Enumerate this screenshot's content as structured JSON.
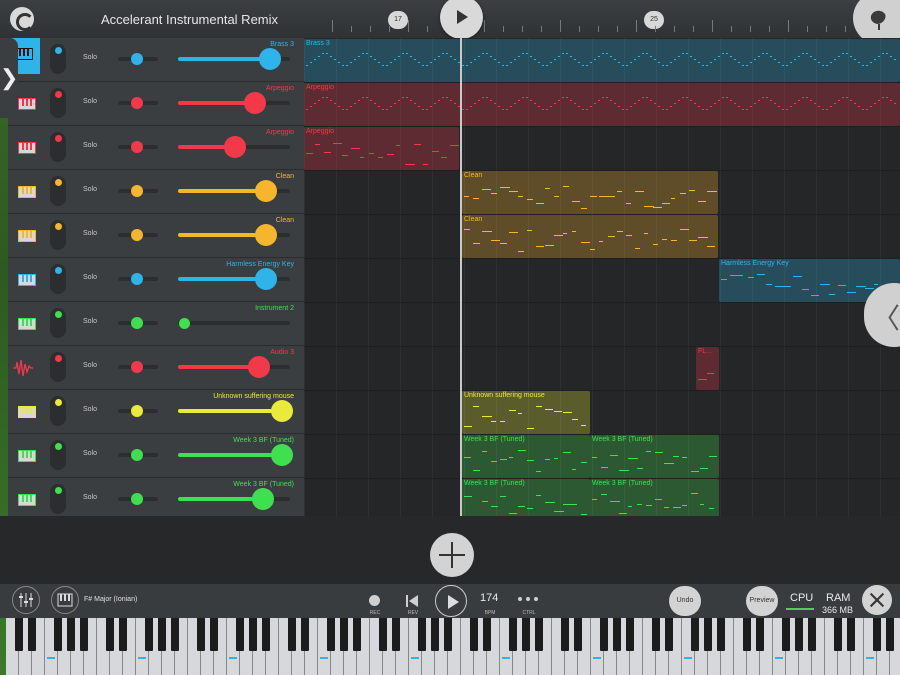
{
  "header": {
    "title": "Accelerant Instrumental Remix",
    "bar_markers": [
      "17",
      "25"
    ]
  },
  "colors": {
    "blue": "#2fb4e9",
    "red": "#f2394a",
    "orange": "#f5b52c",
    "green": "#3fe04f",
    "yellow": "#eaea3a"
  },
  "channels": [
    {
      "name": "Brass 3",
      "color": "blue",
      "icon": "piano-keys-icon",
      "solo": "Solo",
      "vol": 0.88,
      "selected": true
    },
    {
      "name": "Arpeggio",
      "color": "red",
      "icon": "piano-keys-icon",
      "solo": "Solo",
      "vol": 0.74
    },
    {
      "name": "Arpeggio",
      "color": "red",
      "icon": "piano-keys-icon",
      "solo": "Solo",
      "vol": 0.55
    },
    {
      "name": "Clean",
      "color": "orange",
      "icon": "piano-keys-icon",
      "solo": "Solo",
      "vol": 0.85
    },
    {
      "name": "Clean",
      "color": "orange",
      "icon": "piano-keys-icon",
      "solo": "Solo",
      "vol": 0.85
    },
    {
      "name": "Harmless Energy Key",
      "color": "blue",
      "icon": "piano-keys-icon",
      "solo": "Solo",
      "vol": 0.85
    },
    {
      "name": "Instrument 2",
      "color": "green",
      "icon": "piano-keys-icon",
      "solo": "Solo",
      "vol": 0.0
    },
    {
      "name": "Audio 3",
      "color": "red",
      "icon": "waveform-icon",
      "solo": "Solo",
      "vol": 0.78
    },
    {
      "name": "Unknown suffering mouse",
      "color": "yellow",
      "icon": "piano-keys-icon",
      "solo": "Solo",
      "vol": 1.0
    },
    {
      "name": "Week 3 BF (Tuned)",
      "color": "green",
      "icon": "piano-keys-icon",
      "solo": "Solo",
      "vol": 1.0
    },
    {
      "name": "Week 3 BF (Tuned)",
      "color": "green",
      "icon": "piano-keys-icon",
      "solo": "Solo",
      "vol": 0.82
    }
  ],
  "clips": [
    {
      "label": "Brass 3",
      "lane": 0,
      "start": 0.0,
      "end": 1.0,
      "color": "blue"
    },
    {
      "label": "Arpeggio",
      "lane": 1,
      "start": 0.0,
      "end": 1.0,
      "color": "red"
    },
    {
      "label": "Arpeggio",
      "lane": 2,
      "start": 0.0,
      "end": 0.26,
      "color": "red"
    },
    {
      "label": "Clean",
      "lane": 3,
      "start": 0.265,
      "end": 0.695,
      "color": "orange"
    },
    {
      "label": "Clean",
      "lane": 4,
      "start": 0.265,
      "end": 0.695,
      "color": "orange"
    },
    {
      "label": "Harmless Energy Key",
      "lane": 5,
      "start": 0.697,
      "end": 1.0,
      "color": "blue"
    },
    {
      "label": "FL...",
      "lane": 7,
      "start": 0.658,
      "end": 0.697,
      "color": "red"
    },
    {
      "label": "Unknown suffering mouse",
      "lane": 8,
      "start": 0.265,
      "end": 0.48,
      "color": "yellow"
    },
    {
      "label": "Week 3 BF (Tuned)",
      "lane": 9,
      "start": 0.265,
      "end": 0.48,
      "color": "green"
    },
    {
      "label": "Week 3 BF (Tuned)",
      "lane": 9,
      "start": 0.48,
      "end": 0.697,
      "color": "green"
    },
    {
      "label": "Week 3 BF (Tuned)",
      "lane": 10,
      "start": 0.265,
      "end": 0.48,
      "color": "green"
    },
    {
      "label": "Week 3 BF (Tuned)",
      "lane": 10,
      "start": 0.48,
      "end": 0.697,
      "color": "green"
    }
  ],
  "transport": {
    "scale": "F# Major (Ionian)",
    "rec": "REC",
    "rev": "REV",
    "bpm_value": "174",
    "bpm_label": "BPM",
    "ctrl": "CTRL",
    "undo": "Undo",
    "preview": "Preview",
    "cpu": "CPU",
    "ram": "RAM",
    "ram_value": "366 MB"
  }
}
